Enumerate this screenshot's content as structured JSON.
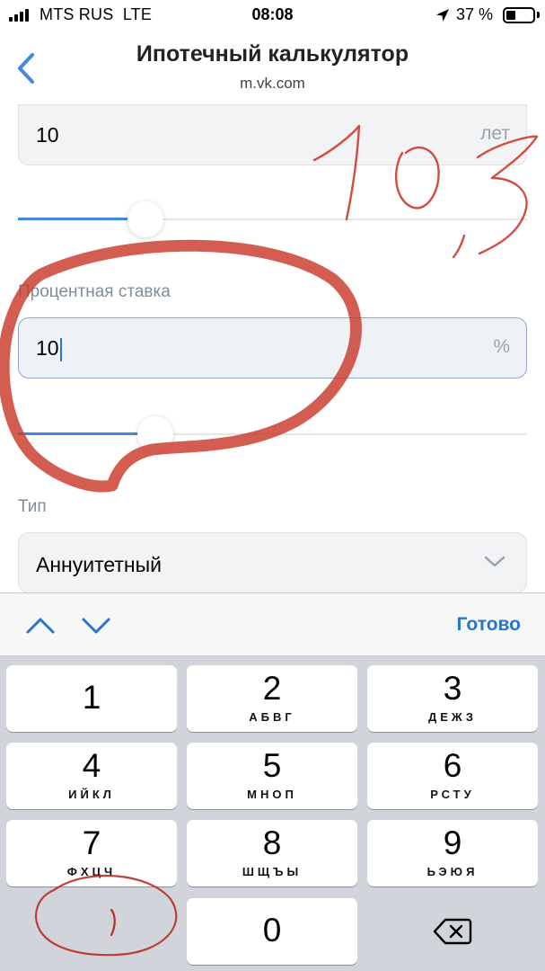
{
  "status_bar": {
    "carrier": "MTS RUS",
    "network": "LTE",
    "time": "08:08",
    "battery": "37 %",
    "battery_level": 0.37,
    "icons": [
      "signal-icon",
      "location-arrow-icon",
      "battery-icon"
    ]
  },
  "nav": {
    "title": "Ипотечный калькулятор",
    "subtitle": "m.vk.com",
    "back_icon": "chevron-left-icon"
  },
  "term": {
    "value": "10",
    "unit": "лет",
    "slider_fraction": 0.25
  },
  "rate": {
    "label": "Процентная ставка",
    "value": "10",
    "unit": "%",
    "slider_fraction": 0.27
  },
  "type": {
    "label": "Тип",
    "value": "Аннуитетный",
    "dropdown_icon": "chevron-down-icon"
  },
  "keyboard": {
    "done_label": "Готово",
    "nav_icons": [
      "chevron-up-icon",
      "chevron-down-icon"
    ],
    "keys": [
      {
        "digit": "1",
        "letters": ""
      },
      {
        "digit": "2",
        "letters": "АБВГ"
      },
      {
        "digit": "3",
        "letters": "ДЕЖЗ"
      },
      {
        "digit": "4",
        "letters": "ИЙКЛ"
      },
      {
        "digit": "5",
        "letters": "МНОП"
      },
      {
        "digit": "6",
        "letters": "РСТУ"
      },
      {
        "digit": "7",
        "letters": "ФХЦЧ"
      },
      {
        "digit": "8",
        "letters": "ШЩЪЫ"
      },
      {
        "digit": "9",
        "letters": "ЬЭЮЯ"
      },
      {
        "digit": "0",
        "letters": ""
      }
    ],
    "delete_icon": "backspace-icon"
  },
  "annotations": {
    "handwritten": "10,3",
    "ink_color": "#d0392b"
  },
  "colors": {
    "accent": "#2975cc",
    "slider_fill": "#3f8ae0",
    "field_bg": "#f2f3f5",
    "keyboard_bg": "#d1d5db"
  }
}
